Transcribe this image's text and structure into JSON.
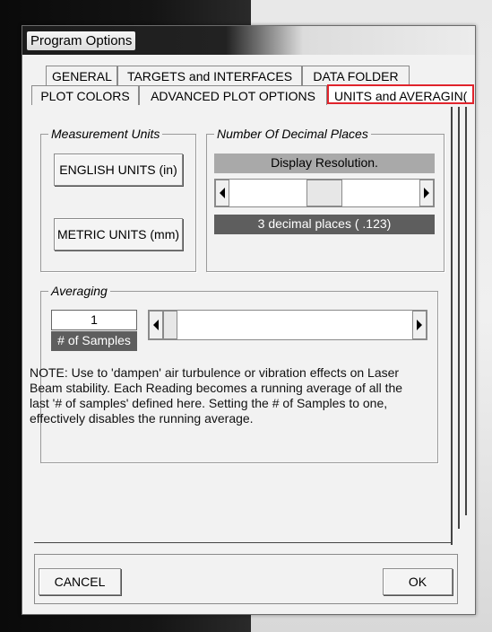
{
  "window": {
    "title": "Program Options"
  },
  "tabs_row1": [
    "GENERAL",
    "TARGETS and INTERFACES",
    "DATA FOLDER"
  ],
  "tabs_row2": [
    "PLOT COLORS",
    "ADVANCED PLOT OPTIONS",
    "UNITS and AVERAGIN("
  ],
  "active_tab": "UNITS and AVERAGIN(",
  "measurement_units": {
    "legend": "Measurement Units",
    "english_label": "ENGLISH UNITS (in)",
    "metric_label": "METRIC UNITS (mm)"
  },
  "decimal_places": {
    "legend": "Number Of Decimal Places",
    "resolution_label": "Display Resolution.",
    "current_label": "3 decimal places ( .123)"
  },
  "averaging": {
    "legend": "Averaging",
    "samples_value": "1",
    "samples_label": "# of Samples",
    "note": "NOTE: Use to 'dampen' air turbulence or vibration effects on Laser Beam stability. Each Reading becomes a running average of all the last '# of samples' defined here. Setting the # of Samples to one, effectively disables the running average."
  },
  "footer": {
    "cancel_label": "CANCEL",
    "ok_label": "OK"
  },
  "colors": {
    "active_tab_outline": "#e0242c",
    "dark_label_bg": "#5e5e5e",
    "gray_label_bg": "#a9a9a9"
  }
}
